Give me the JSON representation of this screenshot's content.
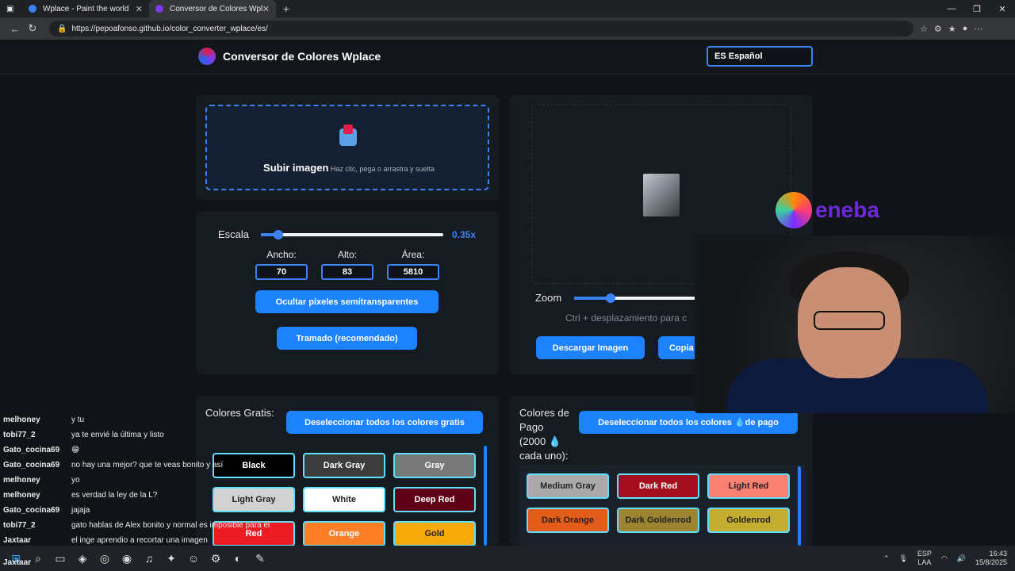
{
  "browser": {
    "tabs": [
      {
        "title": "Wplace - Paint the world",
        "active": false
      },
      {
        "title": "Conversor de Colores Wplace",
        "active": true
      }
    ],
    "url": "https://pepoafonso.github.io/color_converter_wplace/es/"
  },
  "header": {
    "title": "Conversor de Colores Wplace",
    "language": "ES Español"
  },
  "upload": {
    "title": "Subir imagen",
    "subtitle": "Haz clic, pega o arrastra y suelta"
  },
  "controls": {
    "scale_label": "Escala",
    "scale_value": "0.35x",
    "scale_fraction": 0.07,
    "width_label": "Ancho:",
    "width_value": "70",
    "height_label": "Alto:",
    "height_value": "83",
    "area_label": "Área:",
    "area_value": "5810",
    "hide_semitransparent_label": "Ocultar píxeles semitransparentes",
    "dither_label": "Tramado (recomendado)"
  },
  "preview": {
    "zoom_label": "Zoom",
    "zoom_hint": "Ctrl + desplazamiento para c",
    "download_label": "Descargar Imagen",
    "copy_label": "Copia"
  },
  "free_colors": {
    "title": "Colores Gratis:",
    "deselect_label": "Deseleccionar todos los colores gratis",
    "chips": [
      {
        "name": "Black",
        "bg": "#000000",
        "fg": "#ffffff"
      },
      {
        "name": "Dark Gray",
        "bg": "#3c3c3c",
        "fg": "#ffffff"
      },
      {
        "name": "Gray",
        "bg": "#787878",
        "fg": "#ffffff"
      },
      {
        "name": "Light Gray",
        "bg": "#d2d2d2",
        "fg": "#222222"
      },
      {
        "name": "White",
        "bg": "#ffffff",
        "fg": "#222222"
      },
      {
        "name": "Deep Red",
        "bg": "#600018",
        "fg": "#ffffff"
      },
      {
        "name": "Red",
        "bg": "#ed1c24",
        "fg": "#ffffff"
      },
      {
        "name": "Orange",
        "bg": "#ff7f27",
        "fg": "#ffffff"
      },
      {
        "name": "Gold",
        "bg": "#f6aa09",
        "fg": "#222222"
      }
    ]
  },
  "paid_colors": {
    "title_lines": [
      "Colores de",
      "Pago",
      "(2000 💧",
      "cada uno):"
    ],
    "deselect_label": "Deseleccionar todos los colores 💧de pago",
    "chips": [
      {
        "name": "Medium Gray",
        "bg": "#aaaaaa",
        "fg": "#222222"
      },
      {
        "name": "Dark Red",
        "bg": "#a50e1e",
        "fg": "#ffffff"
      },
      {
        "name": "Light Red",
        "bg": "#fa8072",
        "fg": "#222222"
      },
      {
        "name": "Dark Orange",
        "bg": "#e45c1a",
        "fg": "#222222"
      },
      {
        "name": "Dark Goldenrod",
        "bg": "#9c8431",
        "fg": "#222222"
      },
      {
        "name": "Goldenrod",
        "bg": "#c5ad31",
        "fg": "#222222"
      }
    ]
  },
  "overlay": {
    "brand": "eneba"
  },
  "chat": [
    {
      "user": "melhoney",
      "msg": "y tu"
    },
    {
      "user": "tobi77_2",
      "msg": "ya te envié la última y listo"
    },
    {
      "user": "Gato_cocina69",
      "msg": "😁"
    },
    {
      "user": "Gato_cocina69",
      "msg": "no hay una mejor? que te veas bonito y así"
    },
    {
      "user": "melhoney",
      "msg": "yo"
    },
    {
      "user": "melhoney",
      "msg": "es verdad la ley de la L?"
    },
    {
      "user": "Gato_cocina69",
      "msg": "jajaja"
    },
    {
      "user": "tobi77_2",
      "msg": "gato hablas de Alex bonito y normal es imposible para el"
    },
    {
      "user": "Jaxtaar",
      "msg": "el inge aprendio a recortar una imagen"
    }
  ],
  "taskbar": {
    "lang": "ESP",
    "layout": "LAA",
    "time": "16:43",
    "date": "15/8/2025",
    "user_overlay": "Jaxtaar"
  }
}
